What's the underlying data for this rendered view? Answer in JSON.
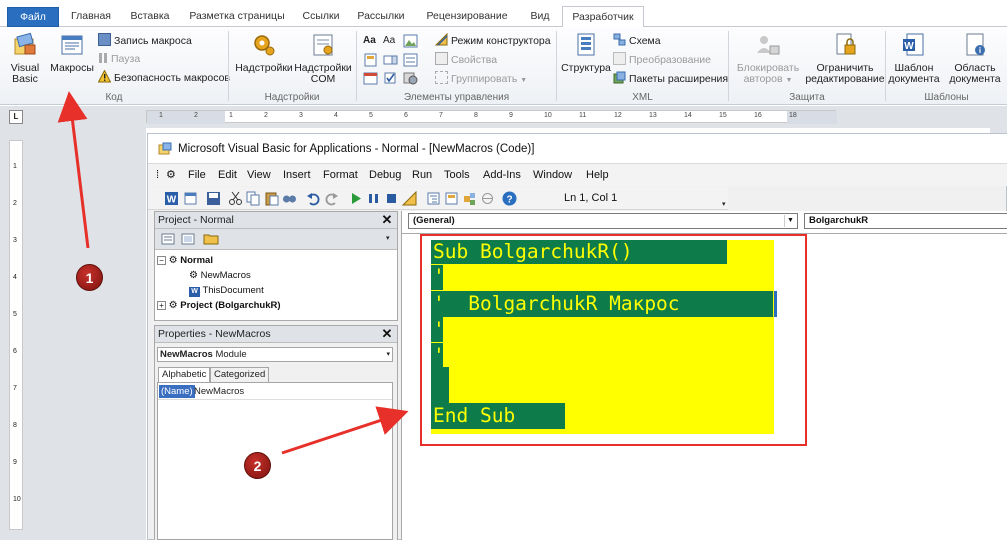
{
  "ribbon": {
    "tabs": [
      "Файл",
      "Главная",
      "Вставка",
      "Разметка страницы",
      "Ссылки",
      "Рассылки",
      "Рецензирование",
      "Вид",
      "Разработчик"
    ],
    "active_tab": "Разработчик",
    "code_group": {
      "label": "Код",
      "visual_basic": "Visual Basic",
      "macros": "Макросы",
      "record_macro": "Запись макроса",
      "pause": "Пауза",
      "macro_security": "Безопасность макросов"
    },
    "addins_group": {
      "label": "Надстройки",
      "addins": "Надстройки",
      "com_addins_line1": "Надстройки",
      "com_addins_line2": "COM"
    },
    "controls_group": {
      "label": "Элементы управления",
      "design_mode": "Режим конструктора",
      "properties": "Свойства",
      "group": "Группировать"
    },
    "xml_group": {
      "label": "XML",
      "structure": "Структура",
      "schema": "Схема",
      "transform": "Преобразование",
      "expansion_packs": "Пакеты расширения"
    },
    "protect_group": {
      "label": "Защита",
      "block_authors_line1": "Блокировать",
      "block_authors_line2": "авторов",
      "restrict_editing_line1": "Ограничить",
      "restrict_editing_line2": "редактирование"
    },
    "templates_group": {
      "label": "Шаблоны",
      "doc_template_line1": "Шаблон",
      "doc_template_line2": "документа",
      "doc_panel_line1": "Область",
      "doc_panel_line2": "документа"
    }
  },
  "ruler": {
    "labels": [
      "1",
      "2",
      "1",
      "2",
      "3",
      "4",
      "5",
      "6",
      "7",
      "8",
      "9",
      "10",
      "11",
      "12",
      "13",
      "14",
      "15",
      "16",
      "18"
    ],
    "vertical_labels": [
      "1",
      "2",
      "3",
      "4",
      "5",
      "6",
      "7",
      "8",
      "9",
      "10"
    ]
  },
  "vba": {
    "title": "Microsoft Visual Basic for Applications - Normal - [NewMacros (Code)]",
    "menus": [
      "File",
      "Edit",
      "View",
      "Insert",
      "Format",
      "Debug",
      "Run",
      "Tools",
      "Add-Ins",
      "Window",
      "Help"
    ],
    "position": "Ln 1, Col 1",
    "project_panel": {
      "title": "Project - Normal",
      "tree": {
        "normal": "Normal",
        "newmacros": "NewMacros",
        "thisdocument": "ThisDocument",
        "project": "Project (BolgarchukR)"
      }
    },
    "properties_panel": {
      "title": "Properties - NewMacros",
      "object_name": "NewMacros",
      "object_type": "Module",
      "tab_alphabetic": "Alphabetic",
      "tab_categorized": "Categorized",
      "row_name_key": "(Name)",
      "row_name_value": "NewMacros"
    },
    "code_window": {
      "object_combo": "(General)",
      "proc_combo": "BolgarchukR",
      "lines": [
        "Sub BolgarchukR()",
        "'",
        "'  BolgarchukR Макрос",
        "'",
        "'",
        "",
        "End Sub"
      ]
    }
  },
  "annotations": {
    "badge1": "1",
    "badge2": "2",
    "color": "#e8302a"
  },
  "colors": {
    "code_highlight": "#ffff00",
    "code_text": "#0d7b4a",
    "file_tab": "#2a6ebf"
  }
}
